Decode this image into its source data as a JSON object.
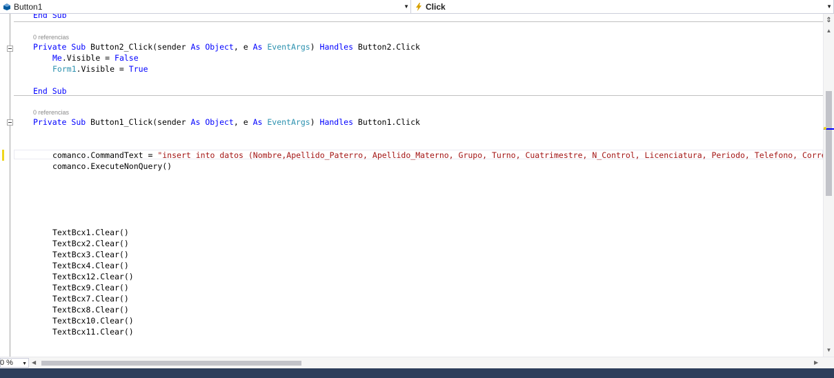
{
  "navbar": {
    "left_combo": {
      "label": "Button1",
      "icon": "vb-class-icon"
    },
    "right_combo": {
      "label": "Click",
      "icon": "event-lightning-icon"
    }
  },
  "editor": {
    "lines": {
      "l0": {
        "kw1": "End",
        "sp": " ",
        "kw2": "Sub"
      },
      "ref1": "0 referencias",
      "l1": {
        "kw_private": "Private",
        "sp1": " ",
        "kw_sub": "Sub",
        "name": " Button2_Click(sender ",
        "kw_as1": "As",
        "sp2": " ",
        "ty_object": "Object",
        "mid": ", e ",
        "kw_as2": "As",
        "sp3": " ",
        "ty_args": "EventArgs",
        "close": ") ",
        "kw_handles": "Handles",
        "tail": " Button2.Click"
      },
      "l2": {
        "kw_me": "Me",
        "mid": ".Visible = ",
        "kw_false": "False"
      },
      "l3": {
        "ty_form": "Form1",
        "mid": ".Visible = ",
        "kw_true": "True"
      },
      "l4": {
        "kw1": "End",
        "sp": " ",
        "kw2": "Sub"
      },
      "ref2": "0 referencias",
      "l5": {
        "kw_private": "Private",
        "sp1": " ",
        "kw_sub": "Sub",
        "name": " Button1_Click(sender ",
        "kw_as1": "As",
        "sp2": " ",
        "ty_object": "Object",
        "mid": ", e ",
        "kw_as2": "As",
        "sp3": " ",
        "ty_args": "EventArgs",
        "close": ") ",
        "kw_handles": "Handles",
        "tail": " Button1.Click"
      },
      "l6": {
        "code": "comanco.CommandText = ",
        "str": "\"insert into datos (Nombre,Apellido_Paterro, Apellido_Materno, Grupo, Turno, Cuatrimestre, N_Control, Licenciatura, Periodo, Telefono, Correo,"
      },
      "l7": "comanco.ExecuteNonQuery()",
      "clears": [
        "TextBcx1.Clear()",
        "TextBcx2.Clear()",
        "TextBcx3.Clear()",
        "TextBcx4.Clear()",
        "TextBcx12.Clear()",
        "TextBcx9.Clear()",
        "TextBcx7.Clear()",
        "TextBcx8.Clear()",
        "TextBcx10.Clear()",
        "TextBcx11.Clear()"
      ]
    }
  },
  "bottom": {
    "zoom": "0 %"
  },
  "colors": {
    "keyword": "#0000ff",
    "type": "#2b91af",
    "string": "#a31515",
    "change_mark": "#efd61c",
    "status_bar": "#2d3e5b"
  }
}
